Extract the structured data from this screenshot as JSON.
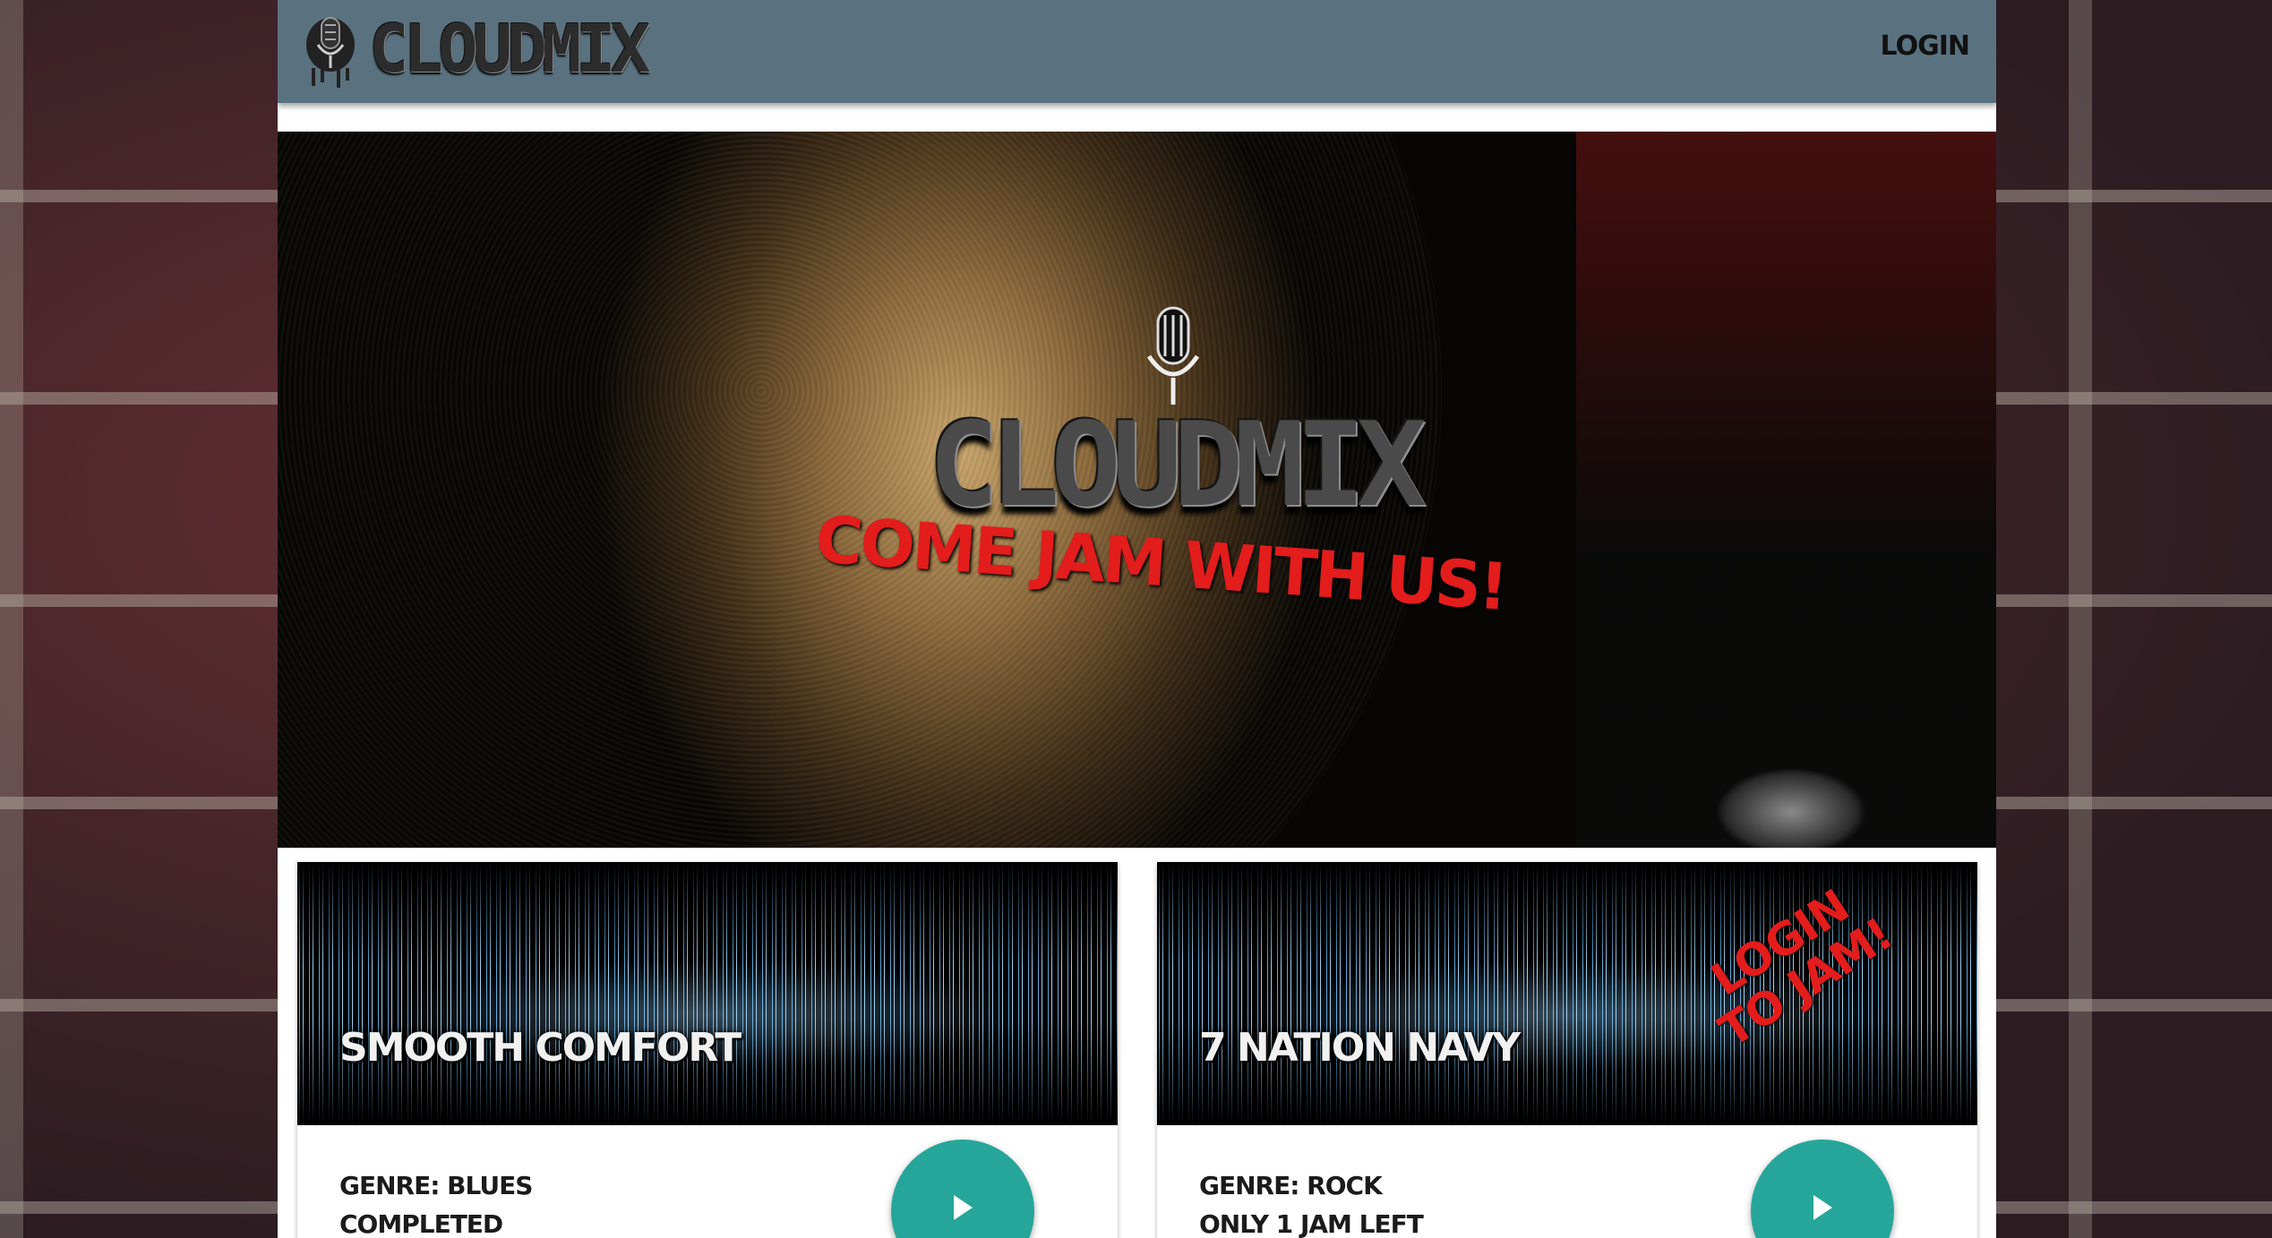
{
  "navbar": {
    "brand": "CLOUDMIX",
    "login": "LOGIN"
  },
  "hero": {
    "brand": "CLOUDMIX",
    "tagline": "COME JAM WITH US!"
  },
  "cards": [
    {
      "title": "SMOOTH COMFORT",
      "genre": "GENRE: BLUES",
      "status": "COMPLETED",
      "play_icon": "play-icon"
    },
    {
      "title": "7 NATION NAVY",
      "genre": "GENRE: ROCK",
      "status": "ONLY 1 JAM LEFT",
      "overlay": "LOGIN TO JAM!",
      "play_icon": "play-icon"
    }
  ],
  "colors": {
    "navbar": "#5a7280",
    "accent_red": "#e31c1c",
    "fab": "#26a69a"
  }
}
